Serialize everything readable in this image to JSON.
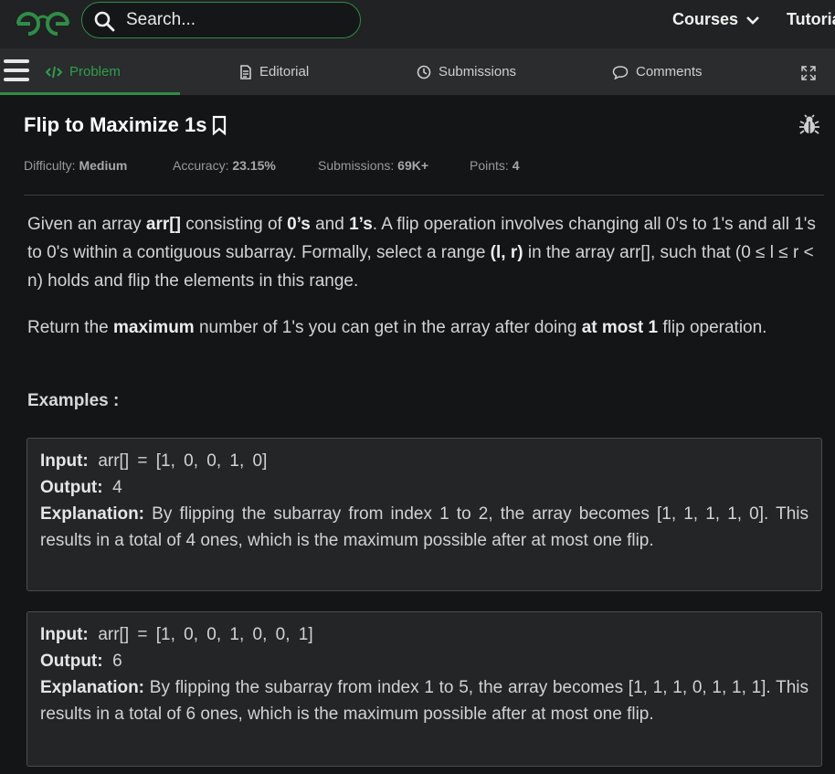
{
  "header": {
    "search_placeholder": "Search...",
    "courses": "Courses",
    "tutorials": "Tutorials",
    "brand_color": "#2f8d46"
  },
  "tabs": {
    "problem": "Problem",
    "editorial": "Editorial",
    "submissions": "Submissions",
    "comments": "Comments"
  },
  "problem": {
    "title": "Flip to Maximize 1s",
    "difficulty_label": "Difficulty:",
    "difficulty": "Medium",
    "accuracy_label": "Accuracy:",
    "accuracy": "23.15%",
    "submissions_label": "Submissions:",
    "submissions": "69K+",
    "points_label": "Points:",
    "points": "4"
  },
  "statement": {
    "p1_a": "Given an array ",
    "p1_b": "arr[]",
    "p1_c": " consisting of ",
    "p1_d": "0’s",
    "p1_e": " and ",
    "p1_f": "1’s",
    "p1_g": ". A flip operation involves changing all 0's to 1's and all 1's to 0's within a contiguous subarray. Formally, select a range ",
    "p1_h": "(l, r)",
    "p1_i": " in the array arr[], such that (0 ≤ l ≤ r < n) holds and flip the elements in this range.",
    "p2_a": "Return the ",
    "p2_b": "maximum",
    "p2_c": " number of 1's you can get in the array after doing ",
    "p2_d": "at most 1",
    "p2_e": " flip operation.",
    "examples_heading": "Examples :"
  },
  "examples": [
    {
      "input_label": "Input:",
      "input": "arr[] = [1, 0, 0, 1, 0]",
      "output_label": "Output:",
      "output": "4",
      "explanation_label": "Explanation:",
      "explanation": "By flipping the subarray from index 1 to 2, the array becomes [1, 1, 1, 1, 0]. This results in a total of 4 ones, which is the maximum possible after at most one flip."
    },
    {
      "input_label": "Input:",
      "input": "arr[] = [1, 0, 0, 1, 0, 0, 1]",
      "output_label": "Output:",
      "output": "6",
      "explanation_label": "Explanation:",
      "explanation": "By flipping the subarray from index 1 to 5, the array becomes [1, 1, 1, 0, 1, 1, 1]. This results in a total of 6 ones, which is the maximum possible after at most one flip."
    }
  ]
}
